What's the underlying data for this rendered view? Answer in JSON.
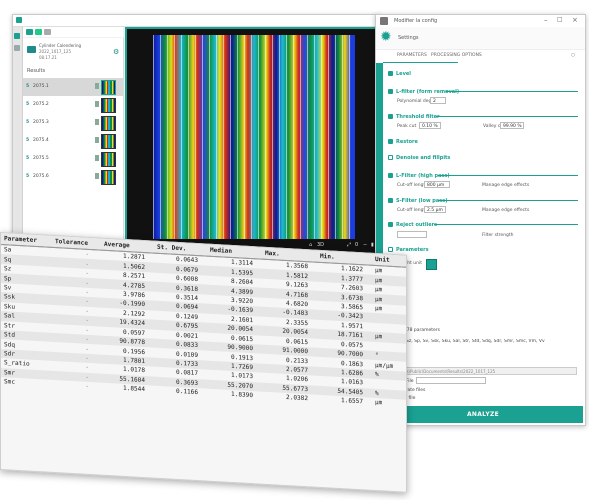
{
  "app": {
    "title": "",
    "folder": {
      "line1": "Cylinder Calendering",
      "line2": "2022_1017_125",
      "line3": "08.17.21"
    },
    "section_label": "Results",
    "files": [
      {
        "num": "5",
        "name": "2075.1"
      },
      {
        "num": "5",
        "name": "2075.2"
      },
      {
        "num": "5",
        "name": "2075.3"
      },
      {
        "num": "5",
        "name": "2075.4"
      },
      {
        "num": "5",
        "name": "2075.5"
      },
      {
        "num": "5",
        "name": "2075.6"
      }
    ],
    "viewport_toolbar": {
      "label_3d": "3D",
      "label_zoom": "0",
      "label_minus": "−"
    },
    "bottom_buttons": [
      "",
      "",
      "GROUPE"
    ]
  },
  "settings": {
    "title": "Modifier la config",
    "gear_title": "Settings",
    "tabs": [
      "PARAMETERS",
      "PROCESSING OPTIONS"
    ],
    "options": {
      "level": "Level",
      "lfilter": "L-filter (form removal)",
      "lfilter_field_label": "Polynomial degree",
      "lfilter_field_value": "2",
      "threshold": "Threshold filter",
      "threshold_field1_label": "Peak cut",
      "threshold_field1_value": "0.10 %",
      "threshold_field2_label": "Valley cut",
      "threshold_field2_value": "99.90 %",
      "restore": "Restore",
      "denoise": "Denoise and fillpits",
      "lfilter_hp": "L-Filter (high pass)",
      "lfilter_hp_field_label": "Cut-off length",
      "lfilter_hp_field_value": "800 µm",
      "lfilter_hp_right": "Manage edge effects",
      "sfilter": "S-Filter (low pass)",
      "sfilter_field_label": "Cut-off length",
      "sfilter_field_value": "2.5 µm",
      "sfilter_right": "Manage edge effects",
      "reject": "Reject outliers",
      "reject_right": "Filter strength",
      "parameters_label": "Parameters",
      "coord_label": "Height unit"
    },
    "param_list_label": "ISO 25178 parameters",
    "param_list": "Sa, Sq, Sz, Sp, Sv, Ssk, Sku, Sal, Str, Std, Sdq, Sdr, Smr, Smc, Vm, Vv",
    "path_box": "C:\\Users\\Public\\Documents\\Results\\2022_1017_125",
    "export_label": "File",
    "export_radio_a": "Separate files",
    "export_radio_b": "Same file",
    "analyze_label": "ANALYZE"
  },
  "results": {
    "headers": [
      "Parameter",
      "Tolerance",
      "Average",
      "St. Dev.",
      "Median",
      "Max.",
      "Min.",
      "Unit"
    ],
    "rows": [
      [
        "Sa",
        "-",
        "1.2871",
        "0.0643",
        "1.3114",
        "1.3568",
        "1.1622",
        "µm"
      ],
      [
        "Sq",
        "-",
        "1.5062",
        "0.0679",
        "1.5395",
        "1.5812",
        "1.3777",
        "µm"
      ],
      [
        "Sz",
        "-",
        "8.2571",
        "0.6008",
        "8.2604",
        "9.1263",
        "7.2603",
        "µm"
      ],
      [
        "Sp",
        "-",
        "4.2785",
        "0.3618",
        "4.3899",
        "4.7168",
        "3.6738",
        "µm"
      ],
      [
        "Sv",
        "-",
        "3.9786",
        "0.3514",
        "3.9220",
        "4.6820",
        "3.5865",
        "µm"
      ],
      [
        "Ssk",
        "-",
        "-0.1990",
        "0.0694",
        "-0.1639",
        "-0.1483",
        "-0.3423",
        ""
      ],
      [
        "Sku",
        "-",
        "2.1292",
        "0.1249",
        "2.1601",
        "2.3355",
        "1.9571",
        ""
      ],
      [
        "Sal",
        "-",
        "19.4324",
        "0.6795",
        "20.0054",
        "20.0054",
        "18.7161",
        "µm"
      ],
      [
        "Str",
        "-",
        "0.0597",
        "0.0021",
        "0.0615",
        "0.0615",
        "0.0575",
        ""
      ],
      [
        "Std",
        "-",
        "90.8778",
        "0.0833",
        "90.9000",
        "91.0000",
        "90.7000",
        "°"
      ],
      [
        "Sdq",
        "-",
        "0.1956",
        "0.0109",
        "0.1913",
        "0.2133",
        "0.1863",
        "µm/µm"
      ],
      [
        "Sdr",
        "-",
        "1.7801",
        "0.1733",
        "1.7269",
        "2.0577",
        "1.6286",
        "%"
      ],
      [
        "S_ratio",
        "-",
        "1.0178",
        "0.0817",
        "1.0173",
        "1.0206",
        "1.0163",
        ""
      ],
      [
        "Smr",
        "-",
        "55.1604",
        "0.3693",
        "55.2070",
        "55.6773",
        "54.5405",
        "%"
      ],
      [
        "Smc",
        "-",
        "1.8544",
        "0.1166",
        "1.8390",
        "2.0382",
        "1.6557",
        "µm"
      ]
    ]
  },
  "colors": {
    "accent": "#1aa192",
    "table_bg": "#f6f6f6"
  }
}
